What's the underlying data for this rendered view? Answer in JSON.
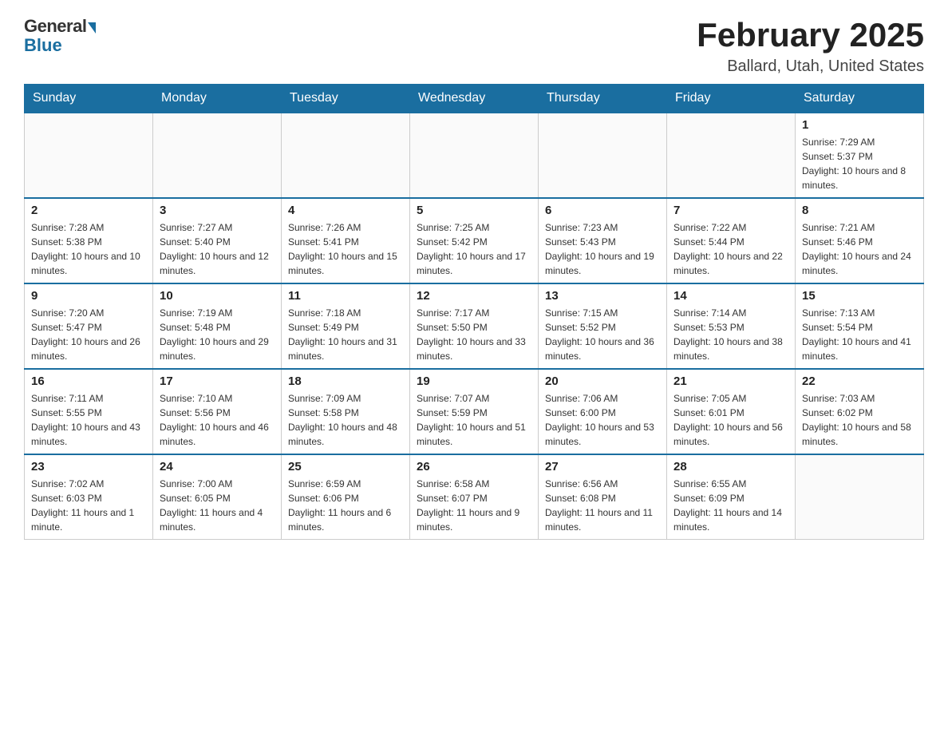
{
  "header": {
    "logo_general": "General",
    "logo_blue": "Blue",
    "month_title": "February 2025",
    "location": "Ballard, Utah, United States"
  },
  "days_of_week": [
    "Sunday",
    "Monday",
    "Tuesday",
    "Wednesday",
    "Thursday",
    "Friday",
    "Saturday"
  ],
  "weeks": [
    [
      {
        "day": "",
        "info": ""
      },
      {
        "day": "",
        "info": ""
      },
      {
        "day": "",
        "info": ""
      },
      {
        "day": "",
        "info": ""
      },
      {
        "day": "",
        "info": ""
      },
      {
        "day": "",
        "info": ""
      },
      {
        "day": "1",
        "info": "Sunrise: 7:29 AM\nSunset: 5:37 PM\nDaylight: 10 hours and 8 minutes."
      }
    ],
    [
      {
        "day": "2",
        "info": "Sunrise: 7:28 AM\nSunset: 5:38 PM\nDaylight: 10 hours and 10 minutes."
      },
      {
        "day": "3",
        "info": "Sunrise: 7:27 AM\nSunset: 5:40 PM\nDaylight: 10 hours and 12 minutes."
      },
      {
        "day": "4",
        "info": "Sunrise: 7:26 AM\nSunset: 5:41 PM\nDaylight: 10 hours and 15 minutes."
      },
      {
        "day": "5",
        "info": "Sunrise: 7:25 AM\nSunset: 5:42 PM\nDaylight: 10 hours and 17 minutes."
      },
      {
        "day": "6",
        "info": "Sunrise: 7:23 AM\nSunset: 5:43 PM\nDaylight: 10 hours and 19 minutes."
      },
      {
        "day": "7",
        "info": "Sunrise: 7:22 AM\nSunset: 5:44 PM\nDaylight: 10 hours and 22 minutes."
      },
      {
        "day": "8",
        "info": "Sunrise: 7:21 AM\nSunset: 5:46 PM\nDaylight: 10 hours and 24 minutes."
      }
    ],
    [
      {
        "day": "9",
        "info": "Sunrise: 7:20 AM\nSunset: 5:47 PM\nDaylight: 10 hours and 26 minutes."
      },
      {
        "day": "10",
        "info": "Sunrise: 7:19 AM\nSunset: 5:48 PM\nDaylight: 10 hours and 29 minutes."
      },
      {
        "day": "11",
        "info": "Sunrise: 7:18 AM\nSunset: 5:49 PM\nDaylight: 10 hours and 31 minutes."
      },
      {
        "day": "12",
        "info": "Sunrise: 7:17 AM\nSunset: 5:50 PM\nDaylight: 10 hours and 33 minutes."
      },
      {
        "day": "13",
        "info": "Sunrise: 7:15 AM\nSunset: 5:52 PM\nDaylight: 10 hours and 36 minutes."
      },
      {
        "day": "14",
        "info": "Sunrise: 7:14 AM\nSunset: 5:53 PM\nDaylight: 10 hours and 38 minutes."
      },
      {
        "day": "15",
        "info": "Sunrise: 7:13 AM\nSunset: 5:54 PM\nDaylight: 10 hours and 41 minutes."
      }
    ],
    [
      {
        "day": "16",
        "info": "Sunrise: 7:11 AM\nSunset: 5:55 PM\nDaylight: 10 hours and 43 minutes."
      },
      {
        "day": "17",
        "info": "Sunrise: 7:10 AM\nSunset: 5:56 PM\nDaylight: 10 hours and 46 minutes."
      },
      {
        "day": "18",
        "info": "Sunrise: 7:09 AM\nSunset: 5:58 PM\nDaylight: 10 hours and 48 minutes."
      },
      {
        "day": "19",
        "info": "Sunrise: 7:07 AM\nSunset: 5:59 PM\nDaylight: 10 hours and 51 minutes."
      },
      {
        "day": "20",
        "info": "Sunrise: 7:06 AM\nSunset: 6:00 PM\nDaylight: 10 hours and 53 minutes."
      },
      {
        "day": "21",
        "info": "Sunrise: 7:05 AM\nSunset: 6:01 PM\nDaylight: 10 hours and 56 minutes."
      },
      {
        "day": "22",
        "info": "Sunrise: 7:03 AM\nSunset: 6:02 PM\nDaylight: 10 hours and 58 minutes."
      }
    ],
    [
      {
        "day": "23",
        "info": "Sunrise: 7:02 AM\nSunset: 6:03 PM\nDaylight: 11 hours and 1 minute."
      },
      {
        "day": "24",
        "info": "Sunrise: 7:00 AM\nSunset: 6:05 PM\nDaylight: 11 hours and 4 minutes."
      },
      {
        "day": "25",
        "info": "Sunrise: 6:59 AM\nSunset: 6:06 PM\nDaylight: 11 hours and 6 minutes."
      },
      {
        "day": "26",
        "info": "Sunrise: 6:58 AM\nSunset: 6:07 PM\nDaylight: 11 hours and 9 minutes."
      },
      {
        "day": "27",
        "info": "Sunrise: 6:56 AM\nSunset: 6:08 PM\nDaylight: 11 hours and 11 minutes."
      },
      {
        "day": "28",
        "info": "Sunrise: 6:55 AM\nSunset: 6:09 PM\nDaylight: 11 hours and 14 minutes."
      },
      {
        "day": "",
        "info": ""
      }
    ]
  ]
}
